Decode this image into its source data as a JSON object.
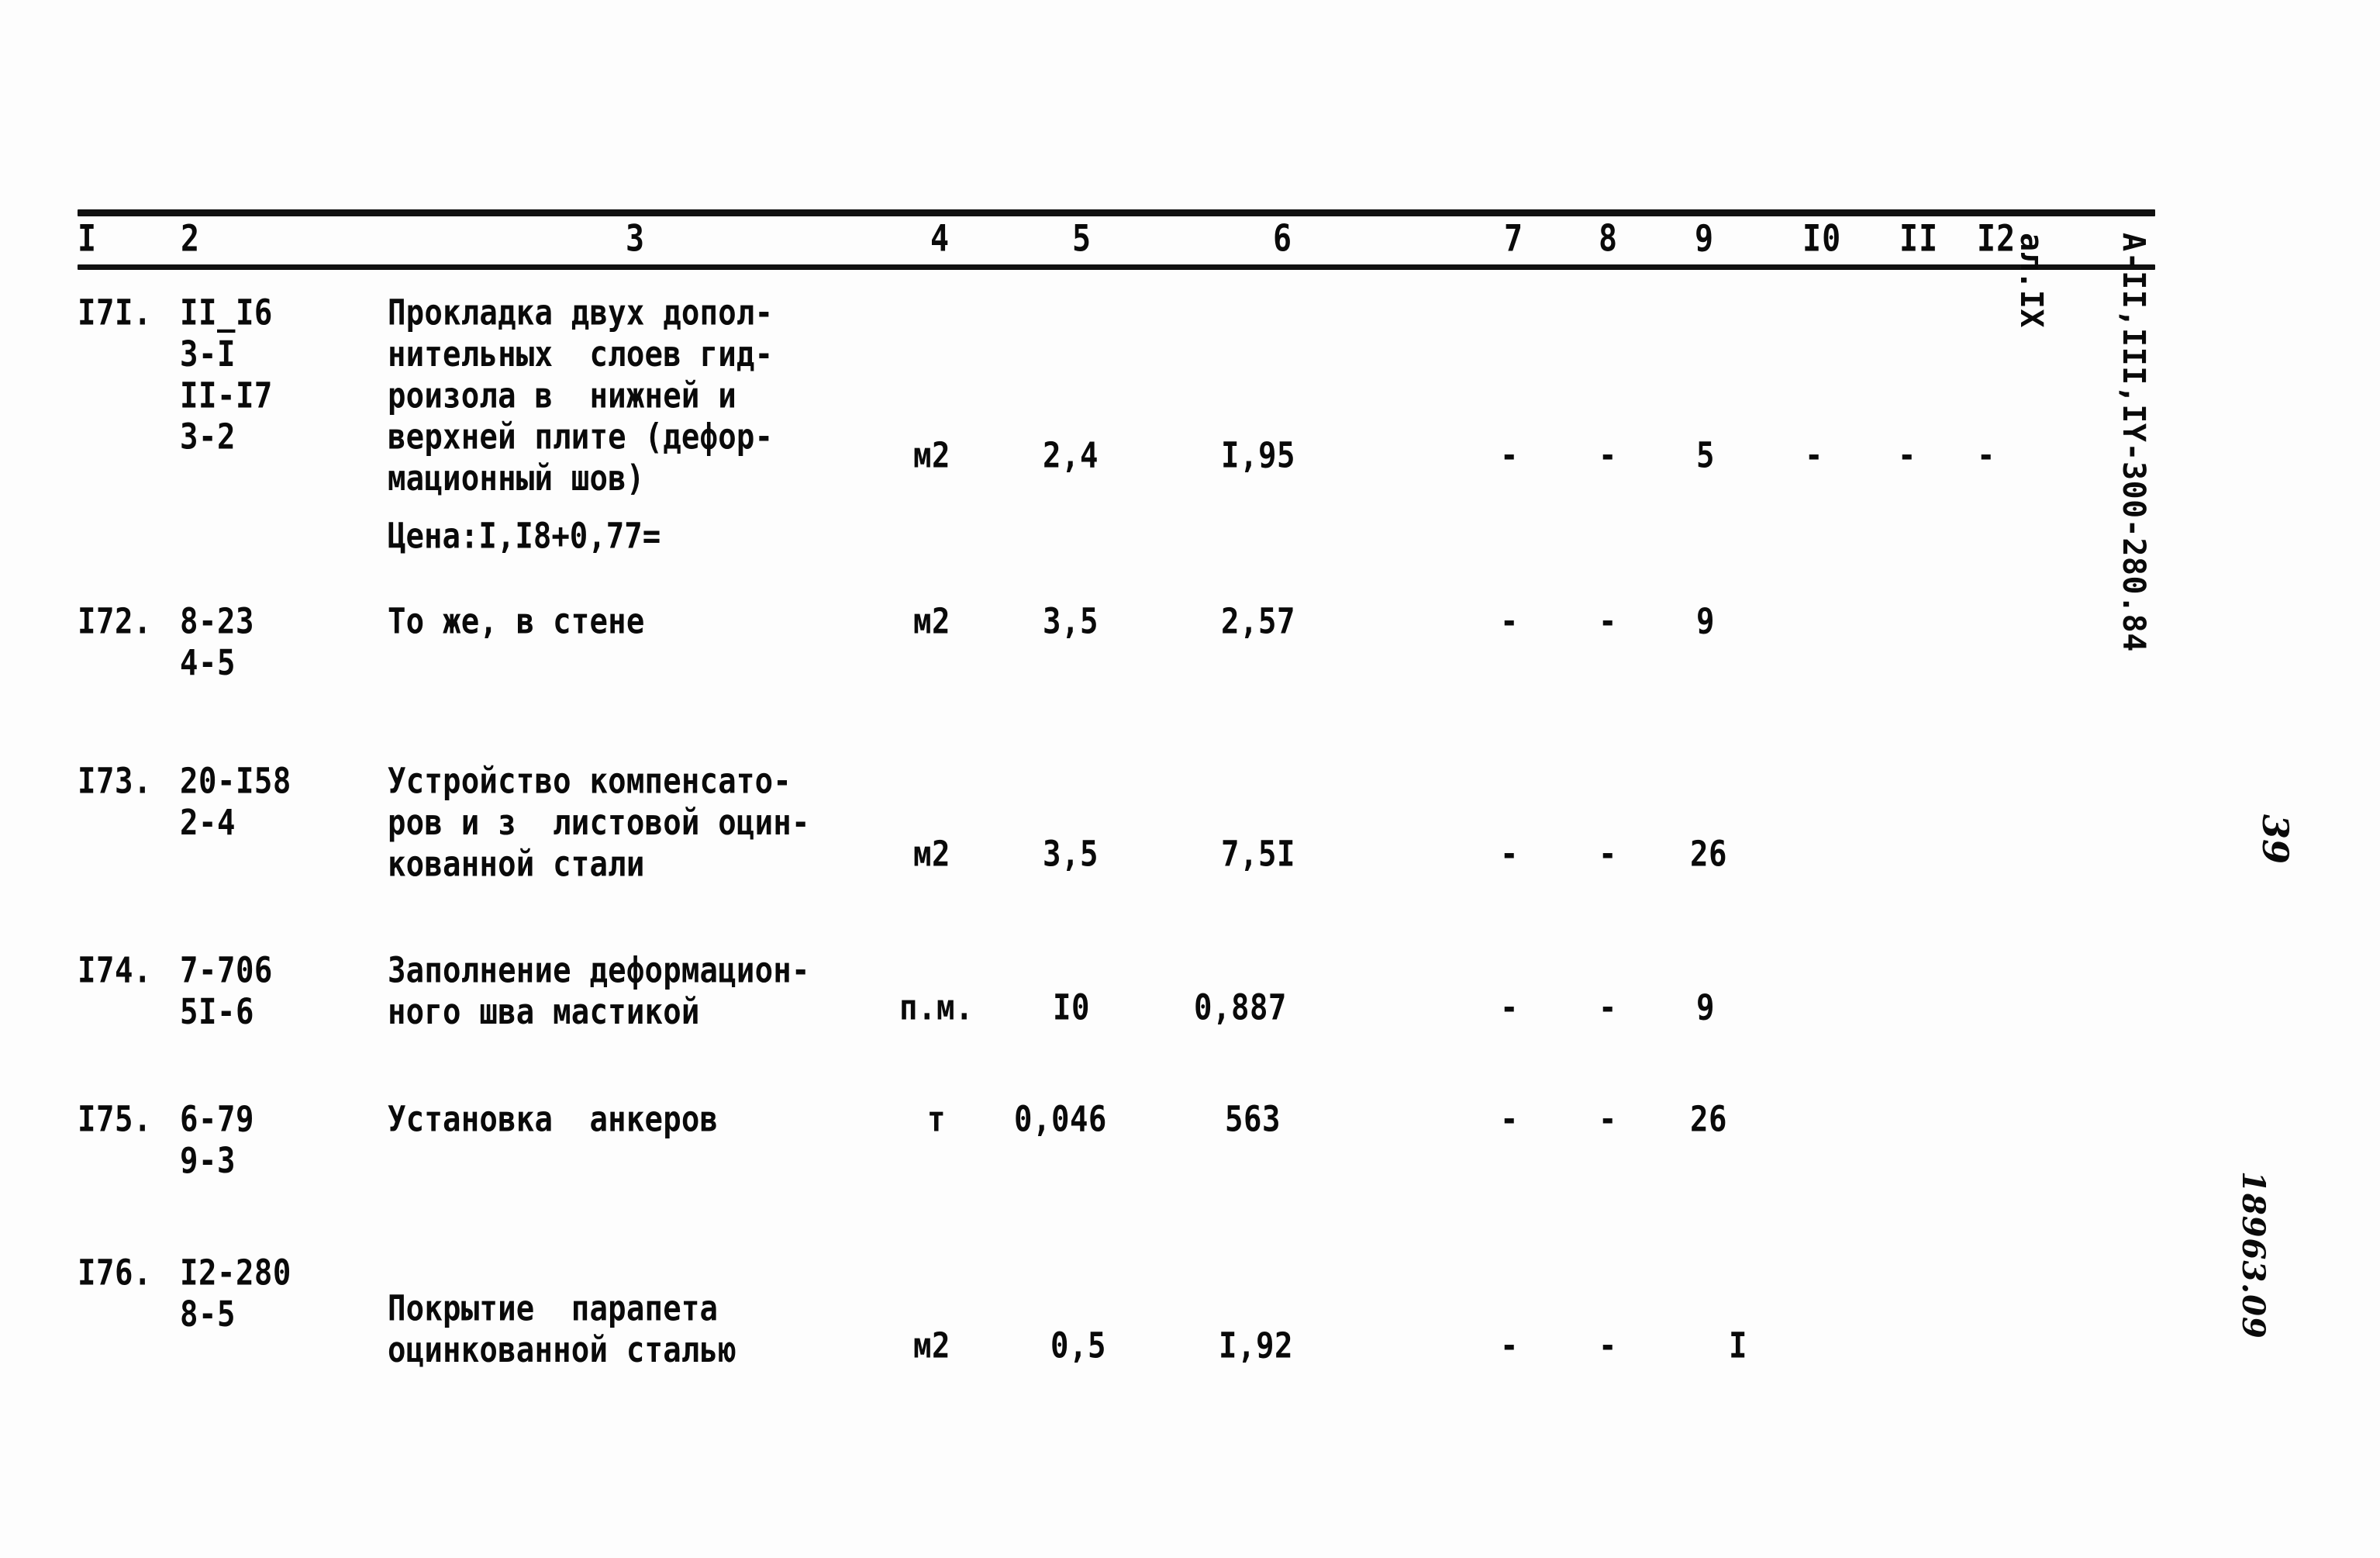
{
  "document": {
    "margin_code_line1": "А-II,III,IY-300-280.84",
    "margin_code_line2": "ал.IX",
    "page_number": "39",
    "archive_stamp": "18963.09"
  },
  "table": {
    "column_headers": [
      "I",
      "2",
      "3",
      "4",
      "5",
      "6",
      "7",
      "8",
      "9",
      "I0",
      "II",
      "I2"
    ],
    "rows": [
      {
        "no": "I7I.",
        "code": "II_I6\n3-I\nII-I7\n3-2",
        "description": "Прокладка двух допол-\nнительных  слоев гид-\nроизола в  нижней и\nверхней плите (дефор-\nмационный шов)",
        "unit": "м2",
        "c5": "2,4",
        "c6": "I,95",
        "c7": "-",
        "c8": "-",
        "c9": "5",
        "c10": "-",
        "c11": "-",
        "c12": "-",
        "note": "Цена:I,I8+0,77="
      },
      {
        "no": "I72.",
        "code": "8-23\n4-5",
        "description": "То же, в стене",
        "unit": "м2",
        "c5": "3,5",
        "c6": "2,57",
        "c7": "-",
        "c8": "-",
        "c9": "9",
        "c10": "",
        "c11": "",
        "c12": "",
        "note": ""
      },
      {
        "no": "I73.",
        "code": "20-I58\n2-4",
        "description": "Устройство компенсато-\nров и з  листовой оцин-\nкованной стали",
        "unit": "м2",
        "c5": "3,5",
        "c6": "7,5I",
        "c7": "-",
        "c8": "-",
        "c9": "26",
        "c10": "",
        "c11": "",
        "c12": "",
        "note": ""
      },
      {
        "no": "I74.",
        "code": "7-706\n5I-6",
        "description": "Заполнение деформацион-\nного шва мастикой",
        "unit": "п.м.",
        "c5": "I0",
        "c6": "0,887",
        "c7": "-",
        "c8": "-",
        "c9": "9",
        "c10": "",
        "c11": "",
        "c12": "",
        "note": ""
      },
      {
        "no": "I75.",
        "code": "6-79\n9-3",
        "description": "Установка  анкеров",
        "unit": "т",
        "c5": "0,046",
        "c6": "563",
        "c7": "-",
        "c8": "-",
        "c9": "26",
        "c10": "",
        "c11": "",
        "c12": "",
        "note": ""
      },
      {
        "no": "I76.",
        "code": "I2-280\n8-5",
        "description": "Покрытие  парапета\nоцинкованной сталью",
        "unit": "м2",
        "c5": "0,5",
        "c6": "I,92",
        "c7": "-",
        "c8": "-",
        "c9": "I",
        "c10": "",
        "c11": "",
        "c12": "",
        "note": ""
      }
    ]
  }
}
